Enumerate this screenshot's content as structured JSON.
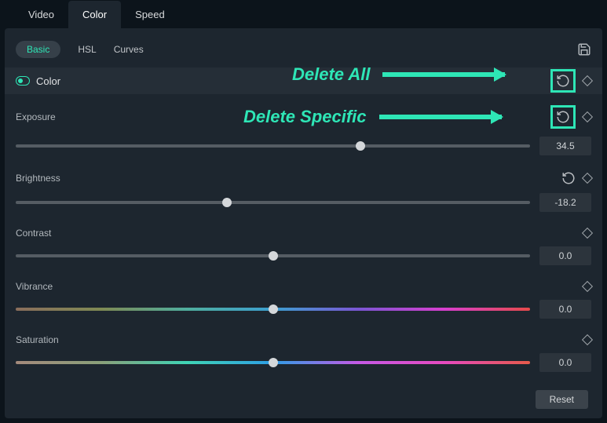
{
  "top_tabs": {
    "video": "Video",
    "color": "Color",
    "speed": "Speed"
  },
  "sub_tabs": {
    "basic": "Basic",
    "hsl": "HSL",
    "curves": "Curves"
  },
  "section": {
    "title": "Color"
  },
  "annotations": {
    "all": "Delete All",
    "specific": "Delete Specific"
  },
  "controls": {
    "exposure": {
      "label": "Exposure",
      "value": "34.5",
      "pos": 67
    },
    "brightness": {
      "label": "Brightness",
      "value": "-18.2",
      "pos": 41
    },
    "contrast": {
      "label": "Contrast",
      "value": "0.0",
      "pos": 50
    },
    "vibrance": {
      "label": "Vibrance",
      "value": "0.0",
      "pos": 50
    },
    "saturation": {
      "label": "Saturation",
      "value": "0.0",
      "pos": 50
    }
  },
  "footer": {
    "reset": "Reset"
  }
}
